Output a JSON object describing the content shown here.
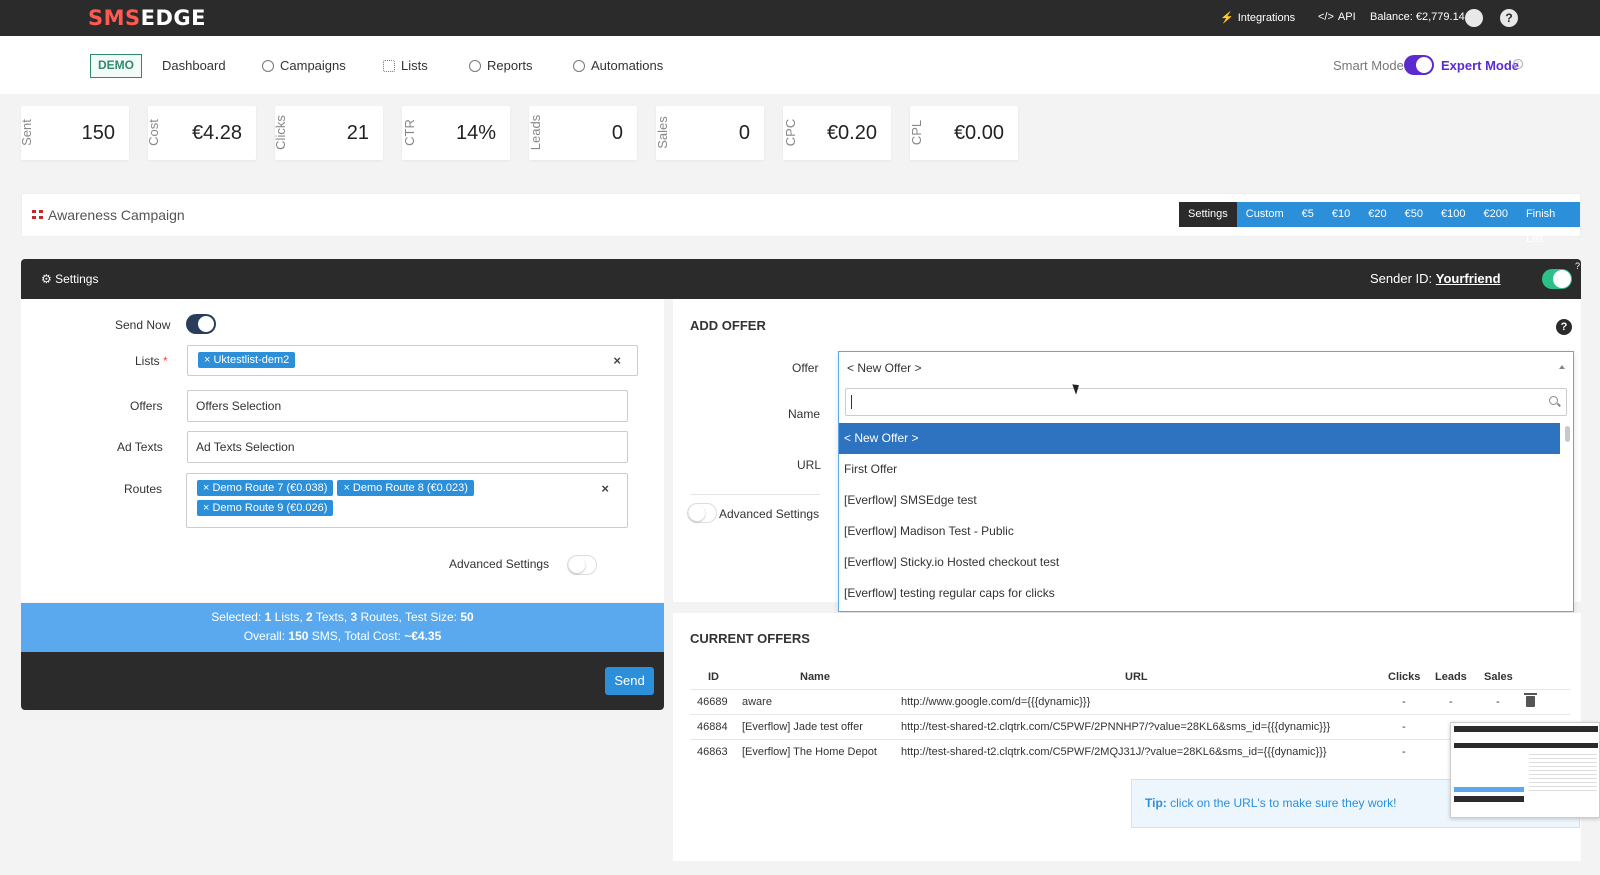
{
  "topbar": {
    "logo_a": "SMS",
    "logo_b": "EDGE",
    "integrations": "Integrations",
    "api": "API",
    "balance": "Balance: €2,779.14",
    "help": "?"
  },
  "nav": {
    "demo": "DEMO",
    "items": [
      "Dashboard",
      "Campaigns",
      "Lists",
      "Reports",
      "Automations"
    ],
    "smart_mode": "Smart Mode",
    "expert_mode": "Expert Mode",
    "info": "i"
  },
  "stats": [
    {
      "label": "Sent",
      "value": "150"
    },
    {
      "label": "Cost",
      "value": "€4.28"
    },
    {
      "label": "Clicks",
      "value": "21"
    },
    {
      "label": "CTR",
      "value": "14%"
    },
    {
      "label": "Leads",
      "value": "0"
    },
    {
      "label": "Sales",
      "value": "0"
    },
    {
      "label": "CPC",
      "value": "€0.20"
    },
    {
      "label": "CPL",
      "value": "€0.00"
    }
  ],
  "campaign": {
    "title": "Awareness Campaign",
    "tabs": [
      "Settings",
      "Custom",
      "€5",
      "€10",
      "€20",
      "€50",
      "€100",
      "€200",
      "Finish List"
    ]
  },
  "settings": {
    "title": "Settings",
    "sender_label": "Sender ID:",
    "sender_value": "Yourfriend",
    "sender_help": "?"
  },
  "form": {
    "send_now": "Send Now",
    "lists": "Lists",
    "required": "*",
    "lists_tag": "Uktestlist-dem2",
    "offers": "Offers",
    "offers_placeholder": "Offers Selection",
    "ad_texts": "Ad Texts",
    "ad_texts_placeholder": "Ad Texts Selection",
    "routes": "Routes",
    "route_tags": [
      "Demo Route 7 (€0.038)",
      "Demo Route 8 (€0.023)",
      "Demo Route 9 (€0.026)"
    ],
    "advanced": "Advanced Settings",
    "clear": "×"
  },
  "summary": {
    "line1_a": "Selected: ",
    "line1_b": "1",
    "line1_c": " Lists, ",
    "line1_d": "2",
    "line1_e": " Texts, ",
    "line1_f": "3",
    "line1_g": " Routes, Test Size: ",
    "line1_h": "50",
    "line2_a": "Overall: ",
    "line2_b": "150",
    "line2_c": " SMS, Total Cost: ",
    "line2_d": "~€4.35"
  },
  "send_button": "Send",
  "add_offer": {
    "title": "ADD OFFER",
    "help": "?",
    "offer_label": "Offer",
    "name_label": "Name",
    "url_label": "URL",
    "advanced": "Advanced Settings",
    "selected": "< New Offer >",
    "options": [
      "< New Offer >",
      "First Offer",
      "[Everflow] SMSEdge test",
      "[Everflow] Madison Test - Public",
      "[Everflow] Sticky.io Hosted checkout test",
      "[Everflow] testing regular caps for clicks"
    ]
  },
  "current_offers": {
    "title": "CURRENT OFFERS",
    "headers": [
      "ID",
      "Name",
      "URL",
      "Clicks",
      "Leads",
      "Sales"
    ],
    "rows": [
      {
        "id": "46689",
        "name": "aware",
        "url": "http://www.google.com/d={{{dynamic}}}",
        "clicks": "-",
        "leads": "-",
        "sales": "-"
      },
      {
        "id": "46884",
        "name": "[Everflow] Jade test offer",
        "url": "http://test-shared-t2.clqtrk.com/C5PWF/2PNNHP7/?value=28KL6&sms_id={{{dynamic}}}",
        "clicks": "-",
        "leads": "",
        "sales": ""
      },
      {
        "id": "46863",
        "name": "[Everflow] The Home Depot",
        "url": "http://test-shared-t2.clqtrk.com/C5PWF/2MQJ31J/?value=28KL6&sms_id={{{dynamic}}}",
        "clicks": "-",
        "leads": "",
        "sales": ""
      }
    ],
    "tip_label": "Tip:",
    "tip_text": " click on the URL's to make sure they work!"
  }
}
